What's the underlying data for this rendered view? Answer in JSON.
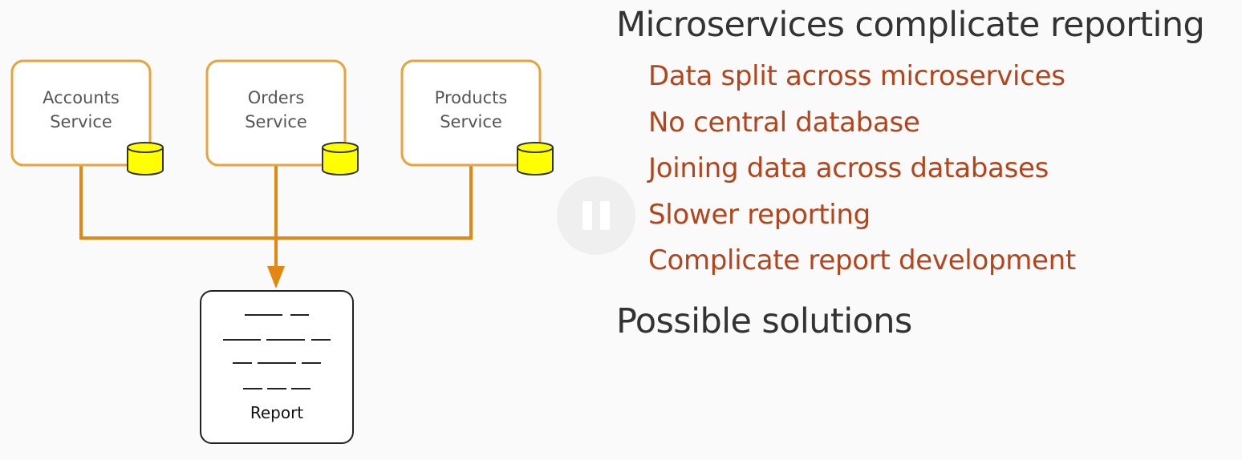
{
  "slide": {
    "title": "Microservices complicate reporting",
    "bullets": [
      "Data split across microservices",
      "No central database",
      "Joining data across databases",
      "Slower reporting",
      "Complicate report development"
    ],
    "subheading": "Possible solutions"
  },
  "diagram": {
    "services": [
      {
        "line1": "Accounts",
        "line2": "Service"
      },
      {
        "line1": "Orders",
        "line2": "Service"
      },
      {
        "line1": "Products",
        "line2": "Service"
      }
    ],
    "report_label": "Report"
  },
  "colors": {
    "service_border": "#e9a33a",
    "connector": "#e4870f",
    "database_fill": "#ffff00",
    "bullet_text": "#b5441b",
    "heading_text": "#333333"
  },
  "icons": {
    "database": "database-icon",
    "pause": "pause-icon"
  }
}
